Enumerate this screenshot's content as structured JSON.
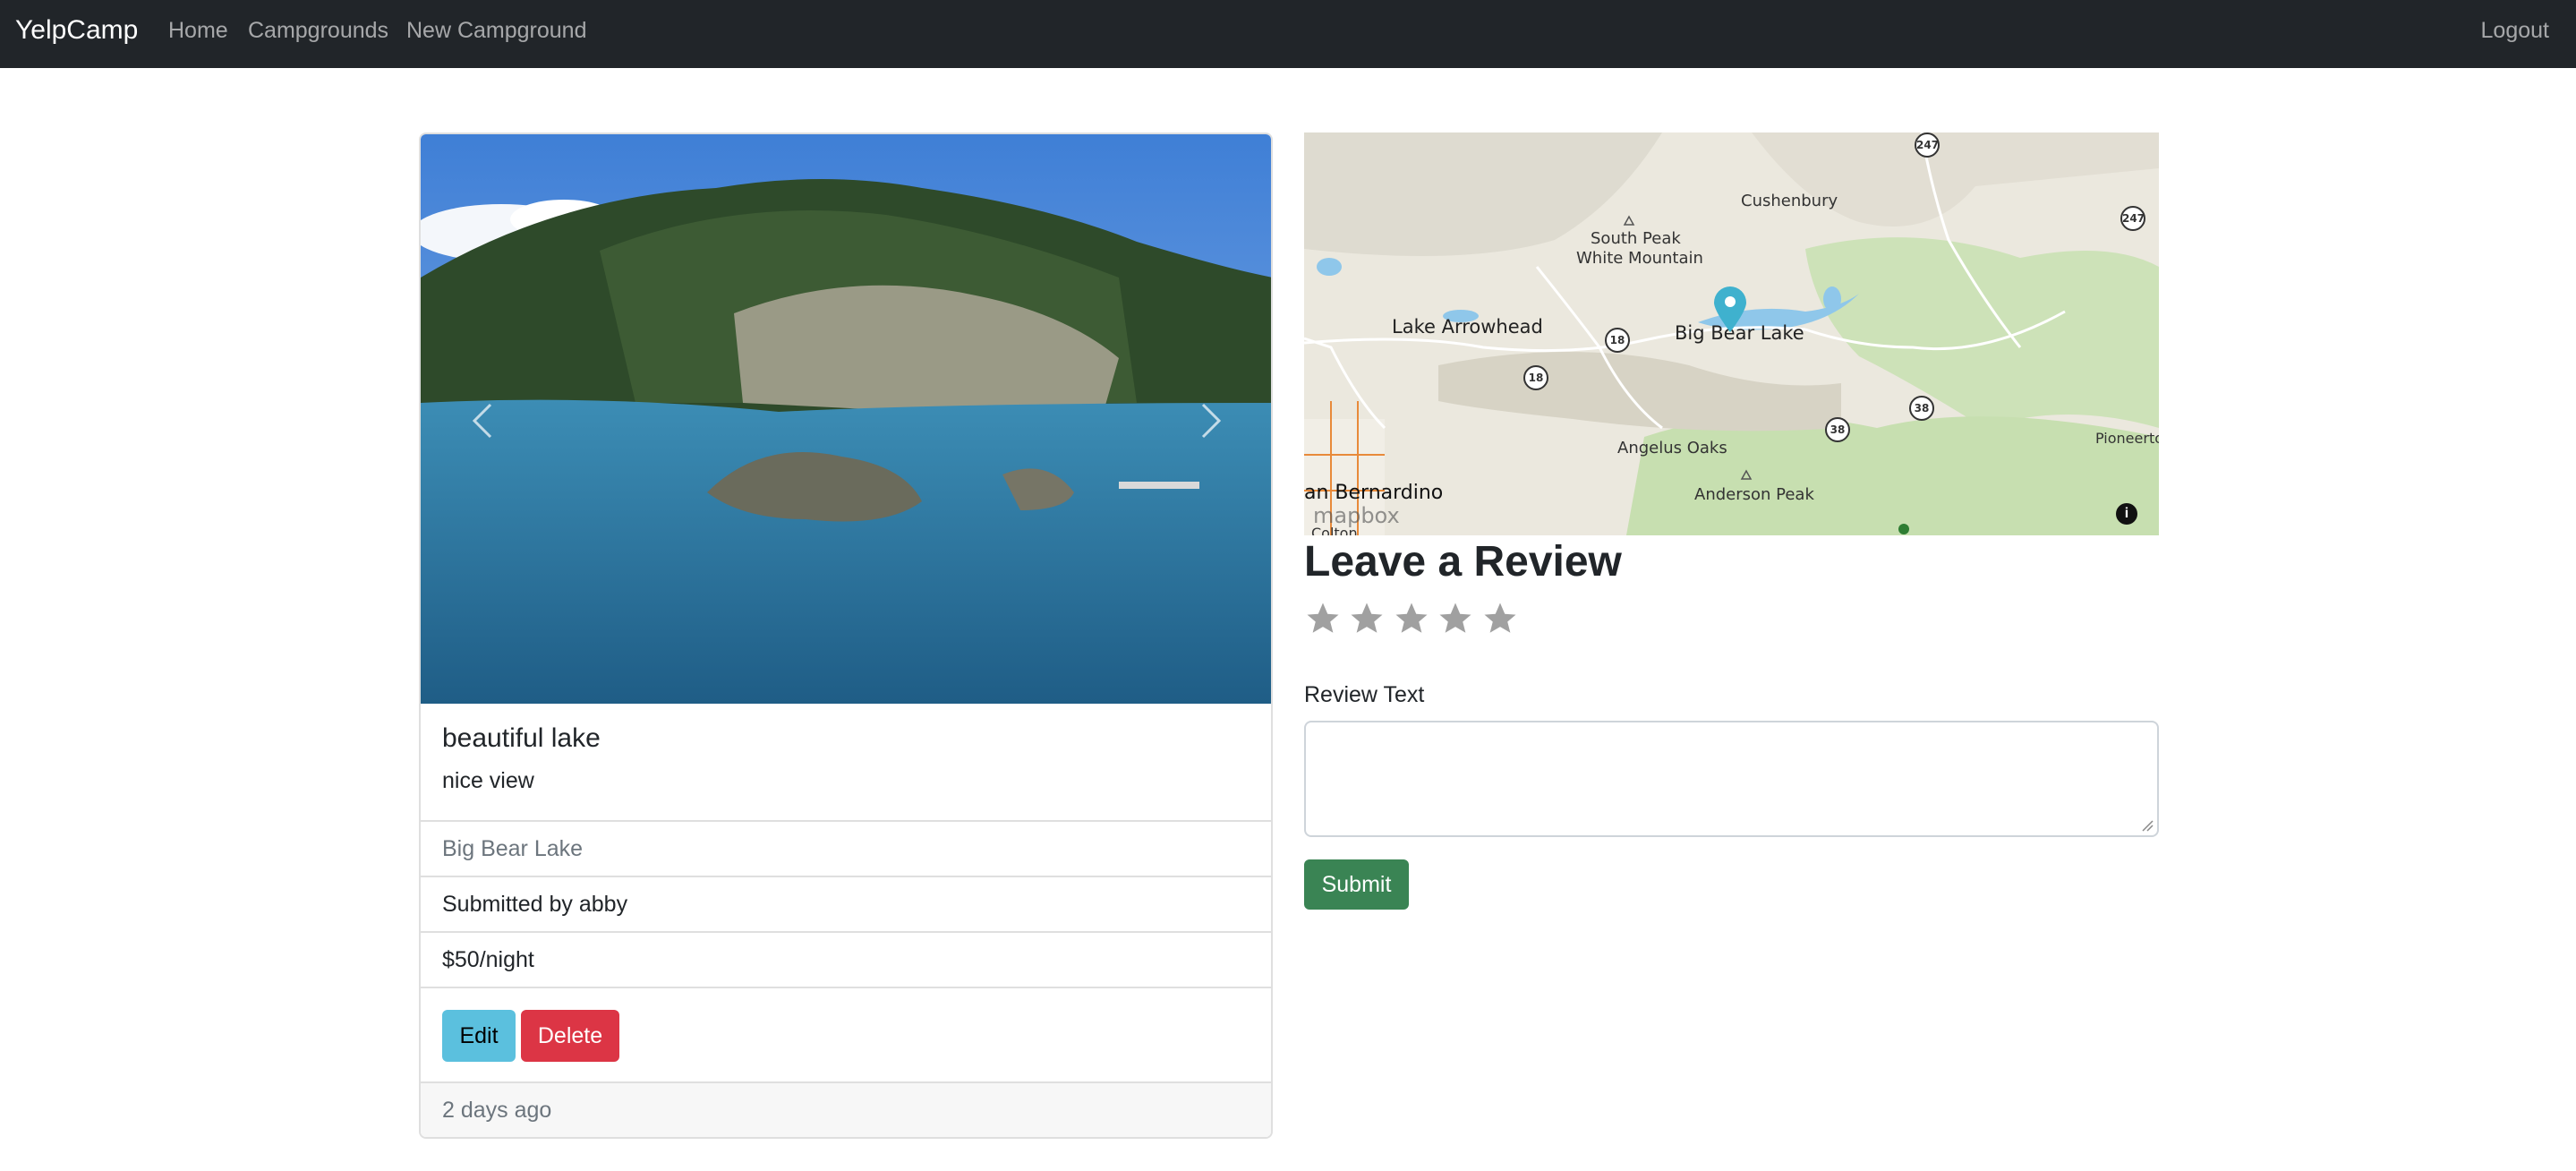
{
  "navbar": {
    "brand": "YelpCamp",
    "links": [
      "Home",
      "Campgrounds",
      "New Campground"
    ],
    "logout": "Logout"
  },
  "campground": {
    "title": "beautiful lake",
    "description": "nice view",
    "location": "Big Bear Lake",
    "submitted_by": "Submitted by abby",
    "price": "$50/night",
    "edit_label": "Edit",
    "delete_label": "Delete",
    "posted": "2 days ago"
  },
  "map": {
    "labels": {
      "cushenbury": "Cushenbury",
      "south_peak": "South Peak",
      "white_mountain": "White Mountain",
      "lake_arrowhead": "Lake Arrowhead",
      "big_bear_lake": "Big Bear Lake",
      "angelus_oaks": "Angelus Oaks",
      "anderson_peak": "Anderson Peak",
      "san_bernardino": "an Bernardino",
      "colton": "Colton",
      "pioneertown": "Pioneerto"
    },
    "shields": {
      "r247a": "247",
      "r247b": "247",
      "r18a": "18",
      "r18b": "18",
      "r38a": "38",
      "r38b": "38"
    },
    "attribution": "mapbox"
  },
  "review": {
    "title": "Leave a Review",
    "rating_stars": 5,
    "text_label": "Review Text",
    "text_value": "",
    "submit_label": "Submit"
  },
  "colors": {
    "navbar_bg": "#212529",
    "edit_button": "#5bc0de",
    "delete_button": "#dc3545",
    "submit_button": "#3a8454",
    "star_empty": "#a0a0a0"
  }
}
